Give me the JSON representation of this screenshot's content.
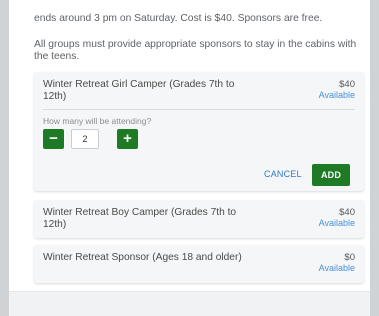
{
  "description": {
    "line1": "ends around 3 pm on Saturday. Cost is $40. Sponsors are free.",
    "line2": "All groups must provide appropriate sponsors to stay in the cabins with the teens."
  },
  "items": [
    {
      "title": "Winter Retreat Girl Camper (Grades 7th to 12th)",
      "price": "$40",
      "status": "Available",
      "expanded": {
        "quantity_label": "How many will be attending?",
        "minus_label": "−",
        "quantity_value": "2",
        "plus_label": "+",
        "cancel_label": "CANCEL",
        "add_label": "ADD"
      }
    },
    {
      "title": "Winter Retreat Boy Camper (Grades 7th to 12th)",
      "price": "$40",
      "status": "Available"
    },
    {
      "title": "Winter Retreat Sponsor (Ages 18 and older)",
      "price": "$0",
      "status": "Available"
    }
  ],
  "colors": {
    "accent_green": "#1f7a25",
    "link_blue": "#2f79c9"
  }
}
